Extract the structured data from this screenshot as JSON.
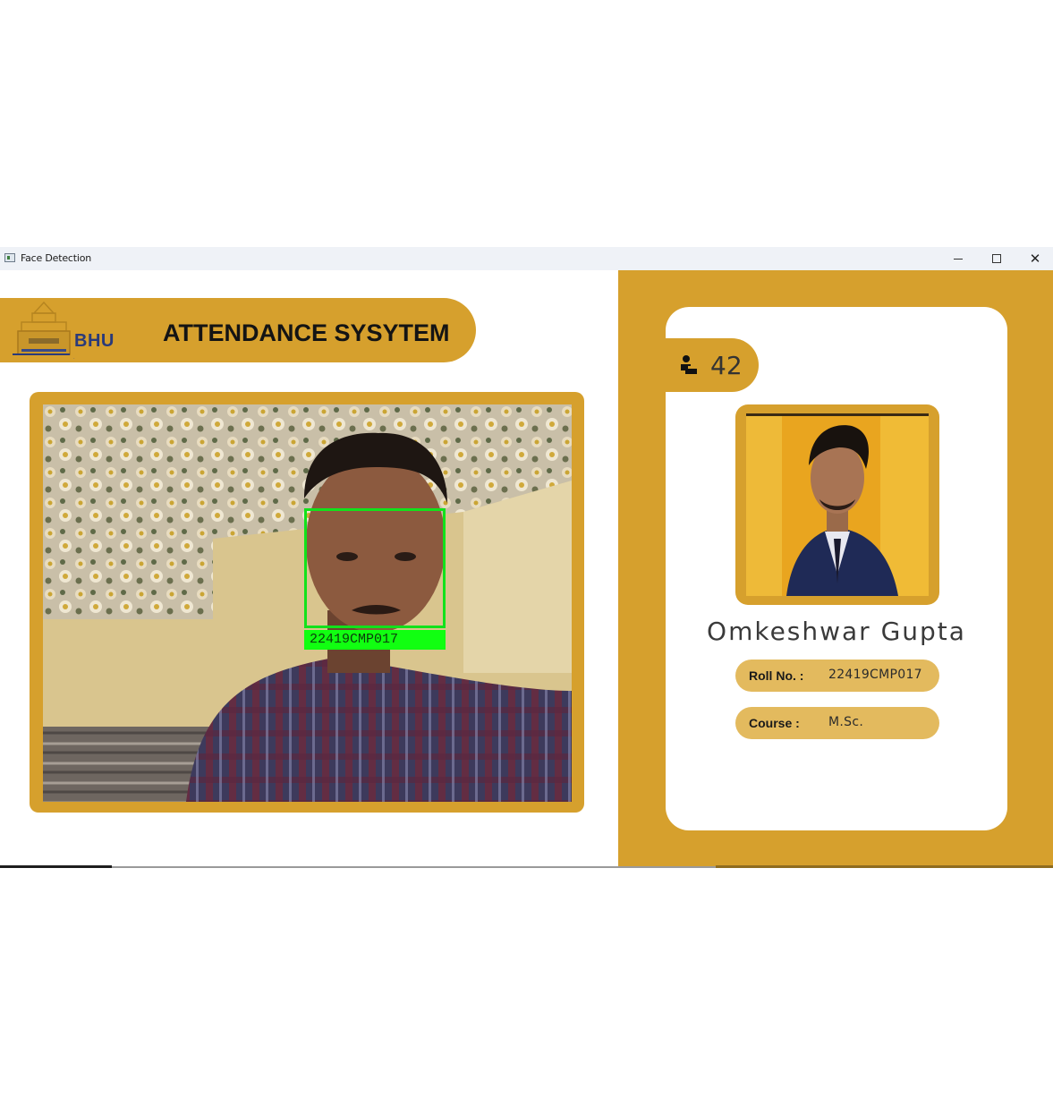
{
  "window": {
    "title": "Face Detection",
    "icon": "app-window-icon",
    "controls": [
      "minimize-icon",
      "maximize-icon",
      "close-icon"
    ]
  },
  "header": {
    "logo_text": "BHU",
    "title": "ATTENDANCE SYSYTEM"
  },
  "camera": {
    "detected_label": "22419CMP017"
  },
  "card": {
    "count_icon": "person-icon",
    "count": "42",
    "student_name": "Omkeshwar  Gupta",
    "roll_label": "Roll No. :",
    "roll_value": "22419CMP017",
    "course_label": "Course :",
    "course_value": "M.Sc."
  },
  "colors": {
    "accent": "#d6a02d",
    "pill": "#e3ba5e",
    "detection_box": "#11e21b"
  }
}
